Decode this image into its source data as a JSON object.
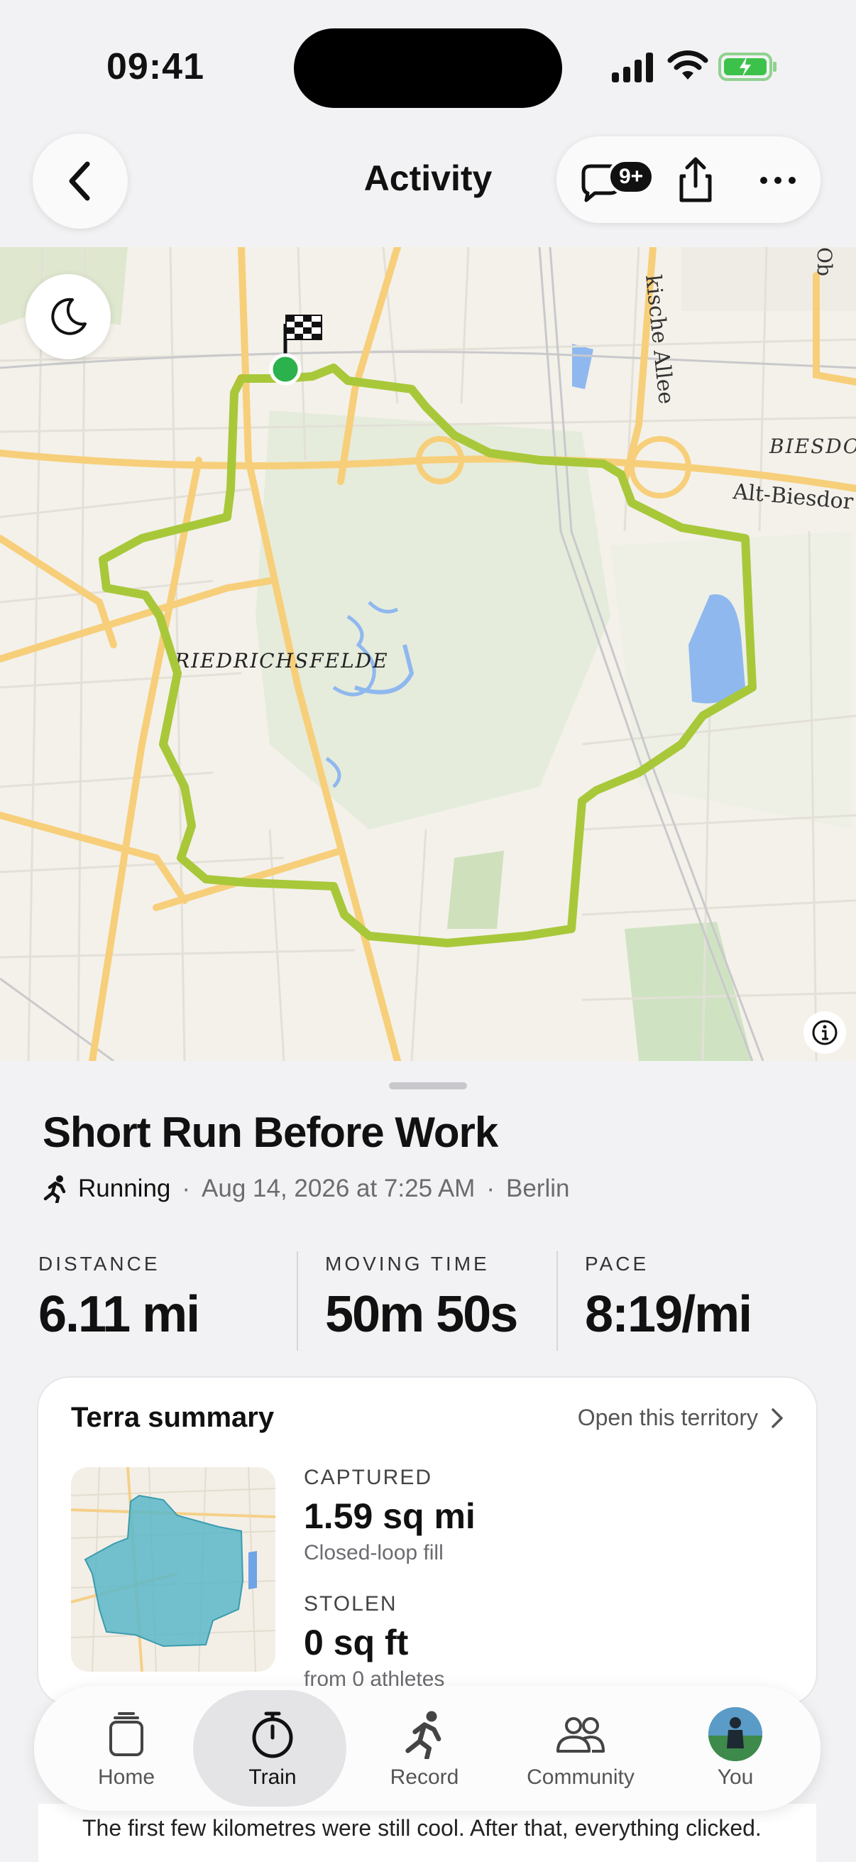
{
  "status": {
    "time": "09:41"
  },
  "header": {
    "title": "Activity",
    "badge": "9+"
  },
  "activity": {
    "name": "Short Run Before Work",
    "sport": "Running",
    "datetime": "Aug 14, 2026 at 7:25 AM",
    "location": "Berlin",
    "separator": "·"
  },
  "map": {
    "labels": {
      "district": "RIEDRICHSFELDE",
      "street1": "kische Allee",
      "street2": "Alt-Biesdor",
      "area": "BIESDO",
      "corner": "Ob"
    }
  },
  "stats": [
    {
      "label": "DISTANCE",
      "value": "6.11 mi"
    },
    {
      "label": "MOVING TIME",
      "value": "50m 50s"
    },
    {
      "label": "PACE",
      "value": "8:19/mi"
    }
  ],
  "terra": {
    "title": "Terra summary",
    "link": "Open this territory",
    "captured_label": "CAPTURED",
    "captured_value": "1.59 sq mi",
    "captured_sub": "Closed-loop fill",
    "stolen_label": "STOLEN",
    "stolen_value": "0 sq ft",
    "stolen_sub": "from 0 athletes"
  },
  "tabs": [
    {
      "label": "Home",
      "icon": "home-icon"
    },
    {
      "label": "Train",
      "icon": "stopwatch-icon",
      "active": true
    },
    {
      "label": "Record",
      "icon": "runner-icon"
    },
    {
      "label": "Community",
      "icon": "people-icon"
    },
    {
      "label": "You",
      "icon": "avatar"
    }
  ],
  "note": "The first few kilometres were still cool. After that, everything clicked.",
  "colors": {
    "route_fast": "#a8c83a",
    "route_mid": "#e8a21c",
    "route_slow": "#d23a2a",
    "start_marker": "#2bb24c",
    "territory": "#5ab7c8"
  }
}
